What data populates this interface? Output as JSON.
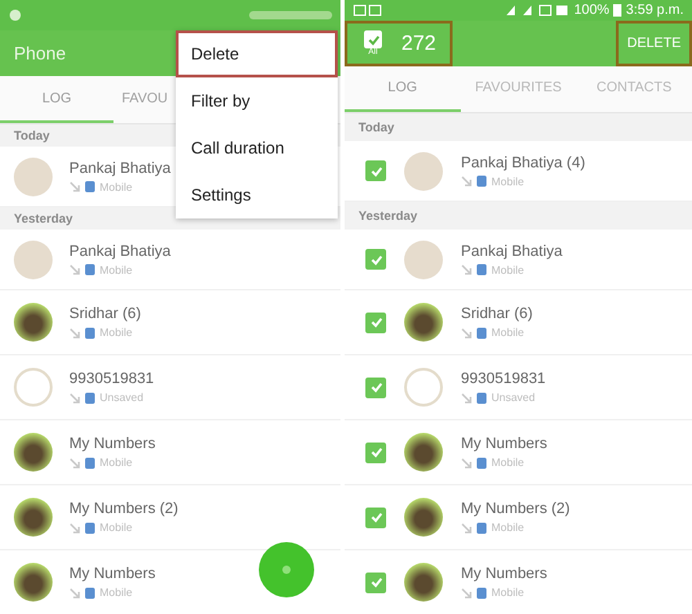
{
  "left_screen": {
    "app_title": "Phone",
    "tabs": [
      {
        "label": "LOG",
        "selected": true
      },
      {
        "label": "FAVOU",
        "selected": false
      }
    ],
    "sections": [
      {
        "header": "Today",
        "rows": [
          {
            "name": "Pankaj Bhatiya",
            "sub": "Mobile",
            "kind": "default"
          }
        ]
      },
      {
        "header": "Yesterday",
        "rows": [
          {
            "name": "Pankaj Bhatiya",
            "sub": "Mobile",
            "kind": "default"
          },
          {
            "name": "Sridhar (6)",
            "sub": "Mobile",
            "kind": "photo"
          },
          {
            "name": "9930519831",
            "sub": "Unsaved",
            "kind": "outline"
          },
          {
            "name": "My Numbers",
            "sub": "Mobile",
            "kind": "photo"
          },
          {
            "name": "My Numbers (2)",
            "sub": "Mobile",
            "kind": "photo"
          },
          {
            "name": "My Numbers",
            "sub": "Mobile",
            "kind": "photo"
          }
        ]
      }
    ],
    "menu": [
      {
        "label": "Delete",
        "highlighted": true
      },
      {
        "label": "Filter by",
        "highlighted": false
      },
      {
        "label": "Call duration",
        "highlighted": false
      },
      {
        "label": "Settings",
        "highlighted": false
      }
    ]
  },
  "right_screen": {
    "battery": "100%",
    "time": "3:59 p.m.",
    "select_all": {
      "checked": true,
      "label": "All",
      "highlighted": true
    },
    "count": "272",
    "delete": {
      "label": "DELETE",
      "highlighted": true
    },
    "tabs": [
      {
        "label": "LOG",
        "selected": true
      },
      {
        "label": "FAVOURITES",
        "selected": false
      },
      {
        "label": "CONTACTS",
        "selected": false
      }
    ],
    "sections": [
      {
        "header": "Today",
        "rows": [
          {
            "name": "Pankaj Bhatiya (4)",
            "sub": "Mobile",
            "kind": "default",
            "checked": true
          }
        ]
      },
      {
        "header": "Yesterday",
        "rows": [
          {
            "name": "Pankaj Bhatiya",
            "sub": "Mobile",
            "kind": "default",
            "checked": true
          },
          {
            "name": "Sridhar (6)",
            "sub": "Mobile",
            "kind": "photo",
            "checked": true
          },
          {
            "name": "9930519831",
            "sub": "Unsaved",
            "kind": "outline",
            "checked": true
          },
          {
            "name": "My Numbers",
            "sub": "Mobile",
            "kind": "photo",
            "checked": true
          },
          {
            "name": "My Numbers (2)",
            "sub": "Mobile",
            "kind": "photo",
            "checked": true
          },
          {
            "name": "My Numbers",
            "sub": "Mobile",
            "kind": "photo",
            "checked": true
          }
        ]
      }
    ]
  }
}
